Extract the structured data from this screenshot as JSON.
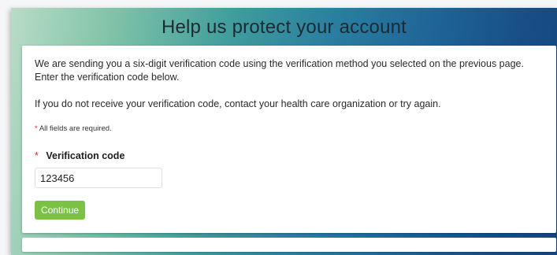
{
  "header": {
    "title": "Help us protect your account"
  },
  "form": {
    "intro": "We are sending you a six-digit verification code using the verification method you selected on the previous page. Enter the verification code below.",
    "help": "If you do not receive your verification code, contact your health care organization or try again.",
    "required_marker": "*",
    "required_note": "All fields are required.",
    "code_label": "Verification code",
    "code_value": "123456",
    "continue_label": "Continue"
  },
  "colors": {
    "accent_button": "#7bc143",
    "required_marker": "#d0302b",
    "header_gradient_start": "#b9dcc6",
    "header_gradient_end": "#15467d"
  }
}
